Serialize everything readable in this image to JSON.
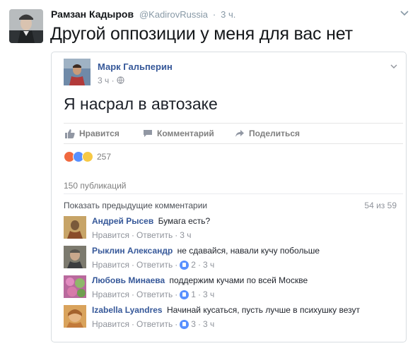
{
  "tweet": {
    "author_name": "Рамзан Кадыров",
    "handle": "@KadirovRussia",
    "dot": "·",
    "time": "3 ч.",
    "text": "Другой оппозиции у меня для вас нет",
    "avatar_icon": "user-avatar-photo",
    "menu_icon": "chevron-down-icon"
  },
  "fb_post": {
    "author_name": "Марк Гальперин",
    "time": "3 ч",
    "privacy_icon": "globe-icon",
    "text": "Я насрал в автозаке",
    "actions": {
      "like": "Нравится",
      "comment": "Комментарий",
      "share": "Поделиться"
    },
    "reactions": {
      "icons": [
        "angry-icon",
        "like-icon",
        "sad-icon"
      ],
      "count": "257"
    },
    "shares": "150 публикаций",
    "show_previous": "Показать предыдущие комментарии",
    "comments_counter": "54 из 59",
    "comments": [
      {
        "author": "Андрей Рысев",
        "text": "Бумага есть?",
        "like": "Нравится",
        "reply": "Ответить",
        "likes": "",
        "time": "3 ч",
        "avatar_color": "#c7a467"
      },
      {
        "author": "Рыклин Александр",
        "text": "не сдавайся, навали кучу побольше",
        "like": "Нравится",
        "reply": "Ответить",
        "likes": "2",
        "time": "3 ч",
        "avatar_color": "#7c7a6e"
      },
      {
        "author": "Любовь Минаева",
        "text": "поддержим кучами по всей Москве",
        "like": "Нравится",
        "reply": "Ответить",
        "likes": "1",
        "time": "3 ч",
        "avatar_color": "#b9699d"
      },
      {
        "author": "Izabella Lyandres",
        "text": "Начинай кусаться, пусть лучше в психушку везут",
        "like": "Нравится",
        "reply": "Ответить",
        "likes": "3",
        "time": "3 ч",
        "avatar_color": "#d9a35c"
      }
    ]
  },
  "colors": {
    "fb_link": "#365899",
    "meta_gray": "#90949c",
    "twitter_gray": "#8899a6",
    "like_blue": "#5890ff"
  }
}
